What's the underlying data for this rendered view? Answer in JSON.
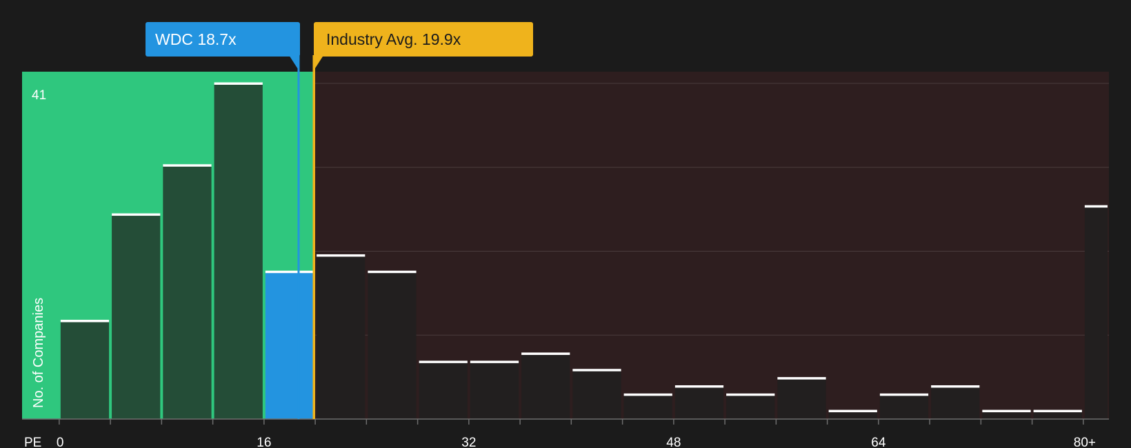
{
  "chart_data": {
    "type": "bar",
    "x_axis_label": "PE",
    "y_axis_label": "No. of Companies",
    "y_max_label": "41",
    "x_ticks": [
      "0",
      "16",
      "32",
      "48",
      "64",
      "80+"
    ],
    "ylim": [
      0,
      41
    ],
    "xlim": [
      -2.9,
      82
    ],
    "bins": [
      {
        "x0": 0,
        "x1": 4,
        "count": 12
      },
      {
        "x0": 4,
        "x1": 8,
        "count": 25
      },
      {
        "x0": 8,
        "x1": 12,
        "count": 31
      },
      {
        "x0": 12,
        "x1": 16,
        "count": 41
      },
      {
        "x0": 16,
        "x1": 20,
        "count": 18
      },
      {
        "x0": 20,
        "x1": 24,
        "count": 20
      },
      {
        "x0": 24,
        "x1": 28,
        "count": 18
      },
      {
        "x0": 28,
        "x1": 32,
        "count": 7
      },
      {
        "x0": 32,
        "x1": 36,
        "count": 7
      },
      {
        "x0": 36,
        "x1": 40,
        "count": 8
      },
      {
        "x0": 40,
        "x1": 44,
        "count": 6
      },
      {
        "x0": 44,
        "x1": 48,
        "count": 3
      },
      {
        "x0": 48,
        "x1": 52,
        "count": 4
      },
      {
        "x0": 52,
        "x1": 56,
        "count": 3
      },
      {
        "x0": 56,
        "x1": 60,
        "count": 5
      },
      {
        "x0": 60,
        "x1": 64,
        "count": 1
      },
      {
        "x0": 64,
        "x1": 68,
        "count": 3
      },
      {
        "x0": 68,
        "x1": 72,
        "count": 4
      },
      {
        "x0": 72,
        "x1": 76,
        "count": 1
      },
      {
        "x0": 76,
        "x1": 80,
        "count": 1
      },
      {
        "x0": 80,
        "x1": 82,
        "count": 26
      }
    ],
    "company": {
      "label": "WDC 18.7x",
      "value": 18.7,
      "highlight_bin_start": 16
    },
    "industry": {
      "label": "Industry Avg. 19.9x",
      "value": 19.9
    },
    "colors": {
      "background": "#1b1b1b",
      "undervalued_zone": "#2fc77e",
      "overvalued_zone": "#2e1e1f",
      "bar_under": "#244d37",
      "bar_over": "#221f1f",
      "bar_highlight": "#2394e0",
      "bar_cap": "#ffffff",
      "company_line": "#2394e0",
      "industry_line": "#efb31c",
      "grid": "#4a3c3d",
      "text": "#ffffff"
    }
  }
}
